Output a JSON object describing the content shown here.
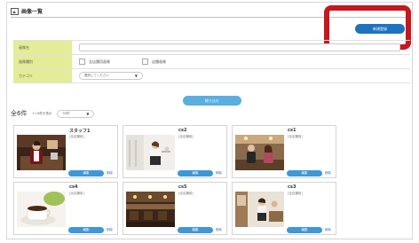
{
  "header": {
    "title": "画像一覧",
    "title_icon": "image-icon"
  },
  "actions": {
    "new_label": "新規登録",
    "search_label": "絞り込む"
  },
  "highlight_color": "#c8161d",
  "form": {
    "name_label": "画像名",
    "name_value": "",
    "type_label": "画像種別",
    "type_options": [
      "全店舗用画像",
      "店舗画像"
    ],
    "category_label": "カテゴリ",
    "category_value": "選択してください"
  },
  "list": {
    "count": "全6件",
    "per_page_label": "1～6件を表示",
    "per_page_value": "50件",
    "cards": [
      {
        "name": "スタッフ1",
        "tag": "[全店舗用]",
        "edit": "編集",
        "delete": "削除"
      },
      {
        "name": "cs2",
        "tag": "[全店舗用]",
        "edit": "編集",
        "delete": "削除"
      },
      {
        "name": "cs1",
        "tag": "[全店舗用]",
        "edit": "編集",
        "delete": "削除"
      },
      {
        "name": "cs4",
        "tag": "[全店舗用]",
        "edit": "編集",
        "delete": "削除"
      },
      {
        "name": "cs5",
        "tag": "[全店舗用]",
        "edit": "編集",
        "delete": "削除"
      },
      {
        "name": "cs3",
        "tag": "[全店舗用]",
        "edit": "編集",
        "delete": "削除"
      }
    ]
  }
}
